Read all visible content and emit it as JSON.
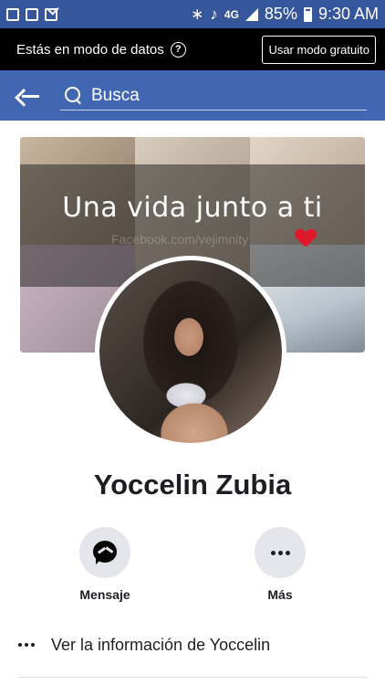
{
  "status_bar": {
    "network": "4G",
    "battery": "85%",
    "time": "9:30 AM"
  },
  "data_mode_bar": {
    "text": "Estás en modo de datos",
    "help_symbol": "?",
    "button_label": "Usar modo gratuito"
  },
  "header": {
    "search_placeholder": "Busca"
  },
  "cover": {
    "caption": "Una vida junto a ti",
    "watermark": "Facebook.com/vejimnity"
  },
  "profile": {
    "name": "Yoccelin Zubia"
  },
  "actions": {
    "message_label": "Mensaje",
    "more_label": "Más"
  },
  "info": {
    "label": "Ver la información de Yoccelin"
  },
  "colors": {
    "status_bar": "#36569b",
    "header": "#4267b2",
    "action_circle": "#e4e6eb",
    "heart": "#e0182b"
  }
}
